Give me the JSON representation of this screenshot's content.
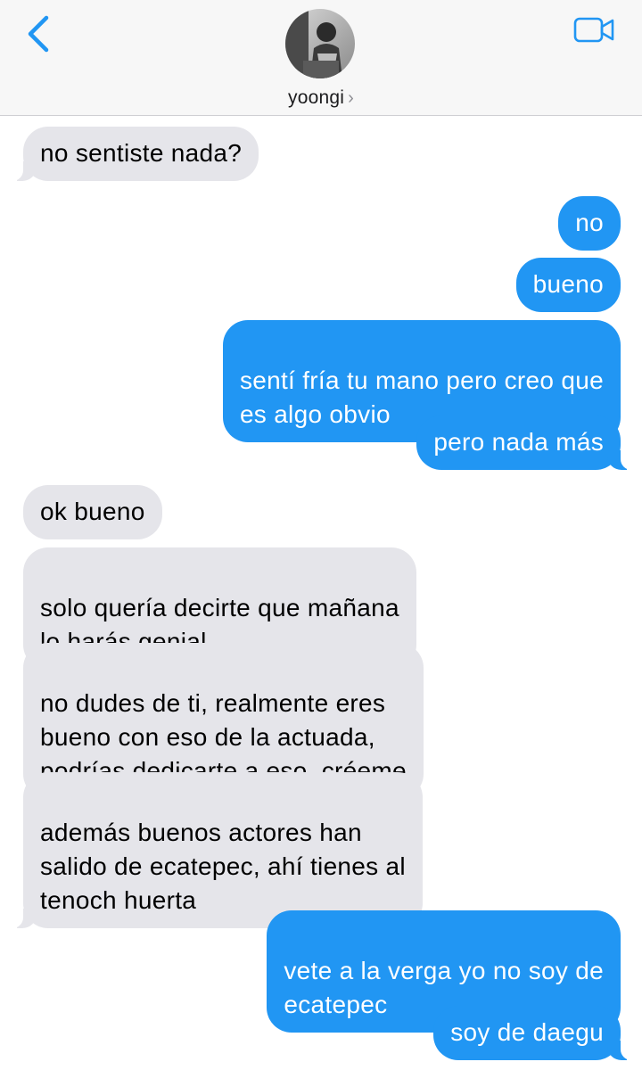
{
  "header": {
    "contact_name": "yoongi",
    "chevron": "›",
    "back_icon": "chevron-left-icon",
    "video_icon": "video-camera-icon"
  },
  "colors": {
    "accent": "#2196f3",
    "incoming_bubble": "#e5e5ea",
    "header_bg": "#f7f7f7"
  },
  "messages": [
    {
      "side": "in",
      "text": "no sentiste nada?"
    },
    {
      "side": "out",
      "text": "no"
    },
    {
      "side": "out",
      "text": "bueno"
    },
    {
      "side": "out",
      "text": "sentí fría tu mano pero creo que\nes algo obvio"
    },
    {
      "side": "out",
      "text": "pero nada más"
    },
    {
      "side": "in",
      "text": "ok bueno"
    },
    {
      "side": "in",
      "text": "solo quería decirte que mañana\nlo harás genial"
    },
    {
      "side": "in",
      "text": "no dudes de ti, realmente eres\nbueno con eso de la actuada,\npodrías dedicarte a eso, créeme"
    },
    {
      "side": "in",
      "text": "además buenos actores han\nsalido de ecatepec, ahí tienes al\ntenoch huerta"
    },
    {
      "side": "out",
      "text": "vete a la verga yo no soy de\necatepec"
    },
    {
      "side": "out",
      "text": "soy de daegu"
    }
  ]
}
